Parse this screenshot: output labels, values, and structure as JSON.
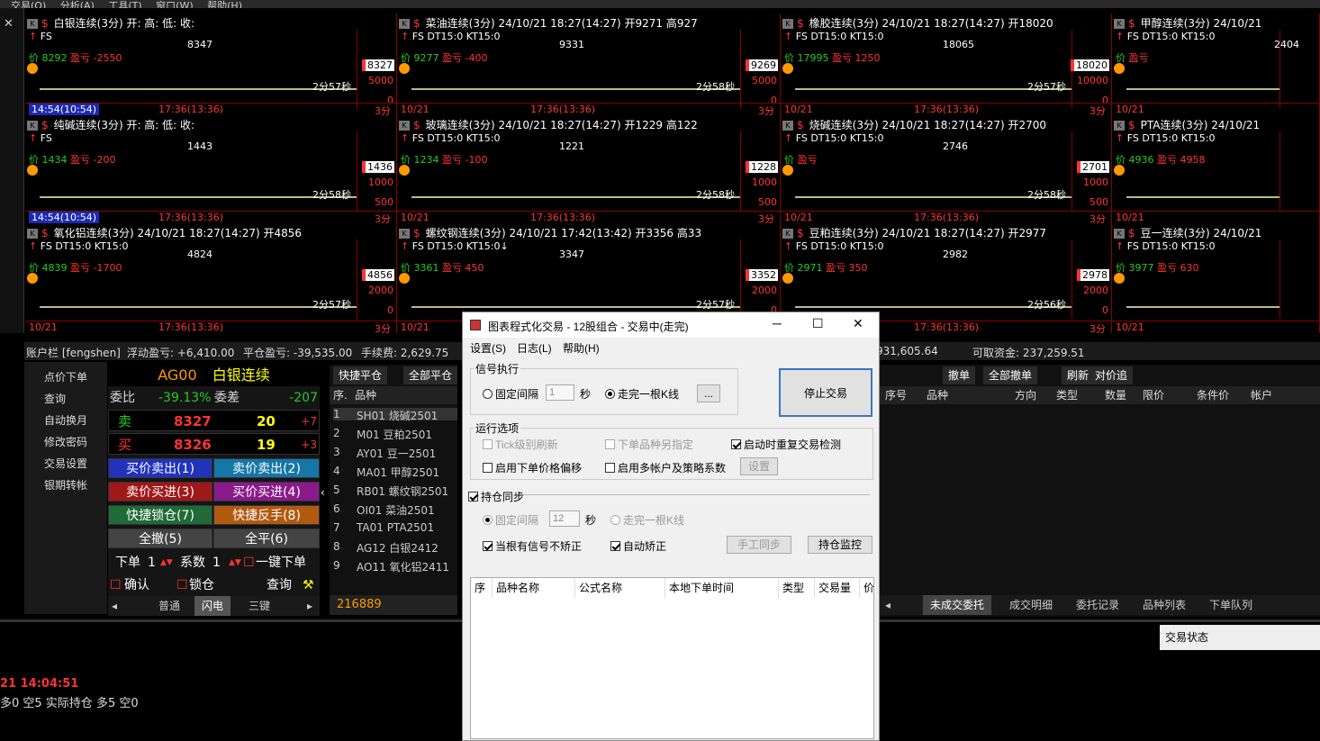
{
  "menubar": [
    "交易(O)",
    "分析(A)",
    "工具(T)",
    "窗口(W)",
    "帮助(H)"
  ],
  "charts": [
    {
      "title": "白银连续(3分) 开: 高: 低: 收:",
      "fs": "FS",
      "price": "8292",
      "pnl": "-2550",
      "lvl": "8327",
      "lvl2": "5000",
      "lvl3": "0",
      "timer": "2分57秒",
      "f1": "14:54(10:54)",
      "f2": "17:36(13:36)",
      "f3": "3分",
      "ann1": "8347"
    },
    {
      "title": "菜油连续(3分) 24/10/21 18:27(14:27) 开9271 高927",
      "fs": "FS DT15:0 KT15:0",
      "price": "9277",
      "pnl": "-400",
      "lvl": "9269",
      "lvl2": "5000",
      "lvl3": "0",
      "timer": "2分58秒",
      "f1": "10/21",
      "f2": "17:36(13:36)",
      "f3": "3分",
      "ann1": "9331"
    },
    {
      "title": "橡胶连续(3分) 24/10/21 18:27(14:27) 开18020",
      "fs": "FS DT15:0 KT15:0",
      "price": "17995",
      "pnl": "1250",
      "lvl": "18020",
      "lvl2": "10000",
      "lvl3": "0",
      "timer": "2分57秒",
      "f1": "10/21",
      "f2": "17:36(13:36)",
      "f3": "3分",
      "ann1": "18065"
    },
    {
      "title": "甲醇连续(3分) 24/10/21",
      "fs": "FS DT15:0 KT15:0",
      "price": "",
      "pnl": "",
      "lvl": "",
      "lvl2": "",
      "lvl3": "",
      "timer": "",
      "f1": "10/21",
      "f2": "",
      "f3": "",
      "ann1": "2404"
    },
    {
      "title": "纯碱连续(3分) 开: 高: 低: 收:",
      "fs": "FS",
      "price": "1434",
      "pnl": "-200",
      "lvl": "1436",
      "lvl2": "1000",
      "lvl3": "500",
      "timer": "2分58秒",
      "f1": "14:54(10:54)",
      "f2": "17:36(13:36)",
      "f3": "3分",
      "ann1": "1443"
    },
    {
      "title": "玻璃连续(3分) 24/10/21 18:27(14:27) 开1229 高122",
      "fs": "FS DT15:0 KT15:0",
      "price": "1234",
      "pnl": "-100",
      "lvl": "1228",
      "lvl2": "1000",
      "lvl3": "500",
      "timer": "2分58秒",
      "f1": "10/21",
      "f2": "17:36(13:36)",
      "f3": "3分",
      "ann1": "1221"
    },
    {
      "title": "烧碱连续(3分) 24/10/21 18:27(14:27) 开2700",
      "fs": "FS DT15:0 KT15:0",
      "price": "",
      "pnl": "",
      "lvl": "2701",
      "lvl2": "1000",
      "lvl3": "500",
      "timer": "2分58秒",
      "f1": "10/21",
      "f2": "17:36(13:36)",
      "f3": "3分",
      "ann1": "2746"
    },
    {
      "title": "PTA连续(3分) 24/10/21",
      "fs": "FS DT15:0 KT15:0",
      "price": "4936",
      "pnl": "4958",
      "lvl": "",
      "lvl2": "",
      "lvl3": "",
      "timer": "",
      "f1": "10/21",
      "f2": "",
      "f3": "",
      "ann1": ""
    },
    {
      "title": "氧化铝连续(3分) 24/10/21 18:27(14:27) 开4856",
      "fs": "FS DT15:0 KT15:0",
      "price": "4839",
      "pnl": "-1700",
      "lvl": "4856",
      "lvl2": "2000",
      "lvl3": "0",
      "timer": "2分57秒",
      "f1": "10/21",
      "f2": "17:36(13:36)",
      "f3": "3分",
      "ann1": "4824"
    },
    {
      "title": "螺纹钢连续(3分) 24/10/21 17:42(13:42) 开3356 高33",
      "fs": "FS DT15:0 KT15:0↓",
      "price": "3361",
      "pnl": "450",
      "lvl": "3352",
      "lvl2": "2000",
      "lvl3": "0",
      "timer": "2分57秒",
      "f1": "10/21",
      "f2": "17:36(13:36)",
      "f3": "3分",
      "ann1": "3347"
    },
    {
      "title": "豆粕连续(3分) 24/10/21 18:27(14:27) 开2977",
      "fs": "FS DT15:0 KT15:0",
      "price": "2971",
      "pnl": "350",
      "lvl": "2978",
      "lvl2": "2000",
      "lvl3": "0",
      "timer": "2分56秒",
      "f1": "10/21",
      "f2": "17:36(13:36)",
      "f3": "3分",
      "ann1": "2982"
    },
    {
      "title": "豆一连续(3分) 24/10/21",
      "fs": "FS DT15:0 KT15:0",
      "price": "3977",
      "pnl": "630",
      "lvl": "",
      "lvl2": "",
      "lvl3": "",
      "timer": "",
      "f1": "10/21",
      "f2": "",
      "f3": "",
      "ann1": ""
    }
  ],
  "price_prefix": "价",
  "pnl_prefix": "盈亏",
  "account": {
    "label": "账户栏 [fengshen]",
    "float": "浮动盈亏: +6,410.00",
    "close": "平仓盈亏: -39,535.00",
    "fee": "手续费: 2,629.75",
    "dyn": "931,605.64",
    "avail": "可取资金: 237,259.51"
  },
  "sidemenu": [
    "点价下单",
    "查询",
    "自动换月",
    "修改密码",
    "交易设置",
    "银期转帐"
  ],
  "quick": {
    "code": "AG00",
    "name": "白银连续",
    "wb_label": "委比",
    "wb": "-39.13%",
    "wc_label": "委差",
    "wc": "-207",
    "sell_label": "卖",
    "sell_price": "8327",
    "sell_qty": "20",
    "sell_chg": "+7",
    "buy_label": "买",
    "buy_price": "8326",
    "buy_qty": "19",
    "buy_chg": "+3",
    "b1": "买价卖出(1)",
    "b2": "卖价卖出(2)",
    "b3": "卖价买进(3)",
    "b4": "买价买进(4)",
    "b5": "快捷锁仓(7)",
    "b6": "快捷反手(8)",
    "b7": "全撤(5)",
    "b8": "全平(6)",
    "order_label": "下单",
    "order_qty": "1",
    "mult_label": "系数",
    "mult_qty": "1",
    "onekey": "一键下单",
    "confirm": "确认",
    "lock": "锁仓",
    "query": "查询",
    "tabs": [
      "普通",
      "闪电",
      "三键"
    ]
  },
  "midtable": {
    "btn1": "快捷平仓",
    "btn2": "全部平仓",
    "h_seq": "序.",
    "h_name": "品种",
    "rows": [
      [
        "1",
        "SH01 烧碱2501"
      ],
      [
        "2",
        "M01 豆粕2501"
      ],
      [
        "3",
        "AY01 豆一2501"
      ],
      [
        "4",
        "MA01 甲醇2501"
      ],
      [
        "5",
        "RB01 螺纹钢2501"
      ],
      [
        "6",
        "OI01 菜油2501"
      ],
      [
        "7",
        "TA01 PTA2501"
      ],
      [
        "8",
        "AG12 白银2412"
      ],
      [
        "9",
        "AO11 氧化铝2411"
      ]
    ],
    "footer": "216889"
  },
  "rightpanel": {
    "btns": [
      "撤单",
      "全部撤单",
      "刷新",
      "对价追"
    ],
    "headers": [
      "序号",
      "品种",
      "方向",
      "类型",
      "数量",
      "限价",
      "条件价",
      "帐户"
    ],
    "tabs": [
      "未成交委托",
      "成交明细",
      "委托记录",
      "品种列表",
      "下单队列"
    ],
    "status": "交易状态"
  },
  "bottom": {
    "line1": "21  14:04:51",
    "line2": "多0 空5 实际持仓 多5 空0"
  },
  "dialog": {
    "title": "图表程式化交易 - 12股组合 - 交易中(走完)",
    "menu": [
      "设置(S)",
      "日志(L)",
      "帮助(H)"
    ],
    "sig_group": "信号执行",
    "fixed": "固定间隔",
    "fixed_val": "1",
    "sec": "秒",
    "walk": "走完一根K线",
    "more": "...",
    "stop": "停止交易",
    "run_group": "运行选项",
    "tick": "Tick级别刷新",
    "alt": "下单品种另指定",
    "restart": "启动时重复交易检测",
    "offset": "启用下单价格偏移",
    "multi": "启用多帐户及策略系数",
    "set": "设置",
    "pos_group": "持仓同步",
    "fixed2": "固定间隔",
    "fixed2_val": "12",
    "sec2": "秒",
    "walk2": "走完一根K线",
    "nofix": "当根有信号不矫正",
    "autofix": "自动矫正",
    "manual": "手工同步",
    "monitor": "持仓监控",
    "grid": [
      "序",
      "品种名称",
      "公式名称",
      "本地下单时间",
      "类型",
      "交易量",
      "价"
    ]
  }
}
